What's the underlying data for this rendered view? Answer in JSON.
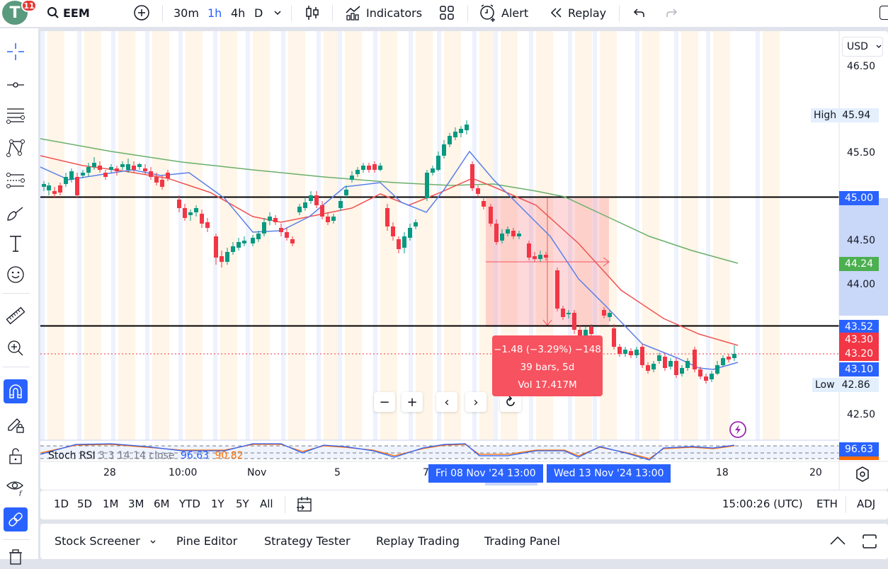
{
  "topbar": {
    "avatar_letter": "T",
    "notification_count": "11",
    "symbol": "EEM",
    "intervals": [
      "30m",
      "1h",
      "4h",
      "D"
    ],
    "active_interval": "1h",
    "indicators_label": "Indicators",
    "alert_label": "Alert",
    "replay_label": "Replay"
  },
  "colors": {
    "accent": "#2962ff",
    "up": "#089981",
    "down": "#f23645",
    "ma_blue": "#5b7fe8",
    "ma_red": "#ef5350",
    "ma_green": "#6aaf6a",
    "measure_fill": "#f7525f"
  },
  "price_axis": {
    "currency": "USD",
    "ticks": [
      "46.50",
      "45.50",
      "44.50",
      "44.00",
      "42.50"
    ],
    "high_label": "High",
    "high_value": "45.94",
    "low_label": "Low",
    "low_value": "42.86",
    "tags": [
      {
        "value": "45.00",
        "color": "#2962ff"
      },
      {
        "value": "44.24",
        "color": "#4caf50"
      },
      {
        "value": "43.52",
        "color": "#2962ff"
      },
      {
        "value": "43.30",
        "color": "#f23645"
      },
      {
        "value": "43.20",
        "color": "#f23645"
      },
      {
        "value": "43.10",
        "color": "#2962ff"
      }
    ],
    "rsi_tag": "96.63"
  },
  "horizontal_lines": [
    "45.00",
    "43.52"
  ],
  "measure": {
    "line1": "−1.48 (−3.29%) −148",
    "line2": "39 bars, 5d",
    "line3": "Vol 17.417M"
  },
  "stoch_rsi": {
    "name": "Stoch RSI",
    "params": "3 3 14 14 close",
    "k_value": "96.63",
    "d_value": "90.82"
  },
  "time_axis": {
    "labels": [
      "28",
      "10:00",
      "Nov",
      "5",
      "7",
      "18",
      "20"
    ],
    "highlight_start": "Fri 08 Nov '24   13:00",
    "highlight_end": "Wed 13 Nov '24   13:00"
  },
  "range_bar": {
    "ranges": [
      "1D",
      "5D",
      "1M",
      "3M",
      "6M",
      "YTD",
      "1Y",
      "5Y",
      "All"
    ],
    "clock": "15:00:26 (UTC)",
    "session": "ETH",
    "adj": "ADJ"
  },
  "bottom_panel": {
    "tabs": [
      "Stock Screener",
      "Pine Editor",
      "Strategy Tester",
      "Replay Trading",
      "Trading Panel"
    ]
  }
}
